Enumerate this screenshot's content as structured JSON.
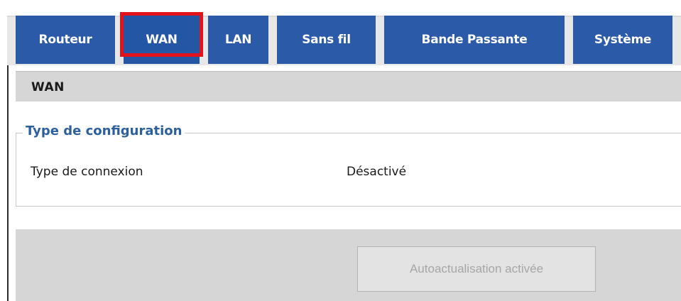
{
  "tabs": [
    {
      "label": "Routeur"
    },
    {
      "label": "WAN",
      "active": true
    },
    {
      "label": "LAN"
    },
    {
      "label": "Sans fil"
    },
    {
      "label": "Bande Passante"
    },
    {
      "label": "Système"
    }
  ],
  "section": {
    "title": "WAN"
  },
  "config": {
    "legend": "Type de configuration",
    "connection_label": "Type de connexion",
    "connection_value": "Désactivé"
  },
  "footer": {
    "refresh_label": "Autoactualisation activée",
    "refresh_enabled": false
  },
  "colors": {
    "tab_bg": "#2b5aa8",
    "highlight": "#e3131b",
    "legend_text": "#2c5f9e",
    "header_bg": "#d6d6d6"
  }
}
